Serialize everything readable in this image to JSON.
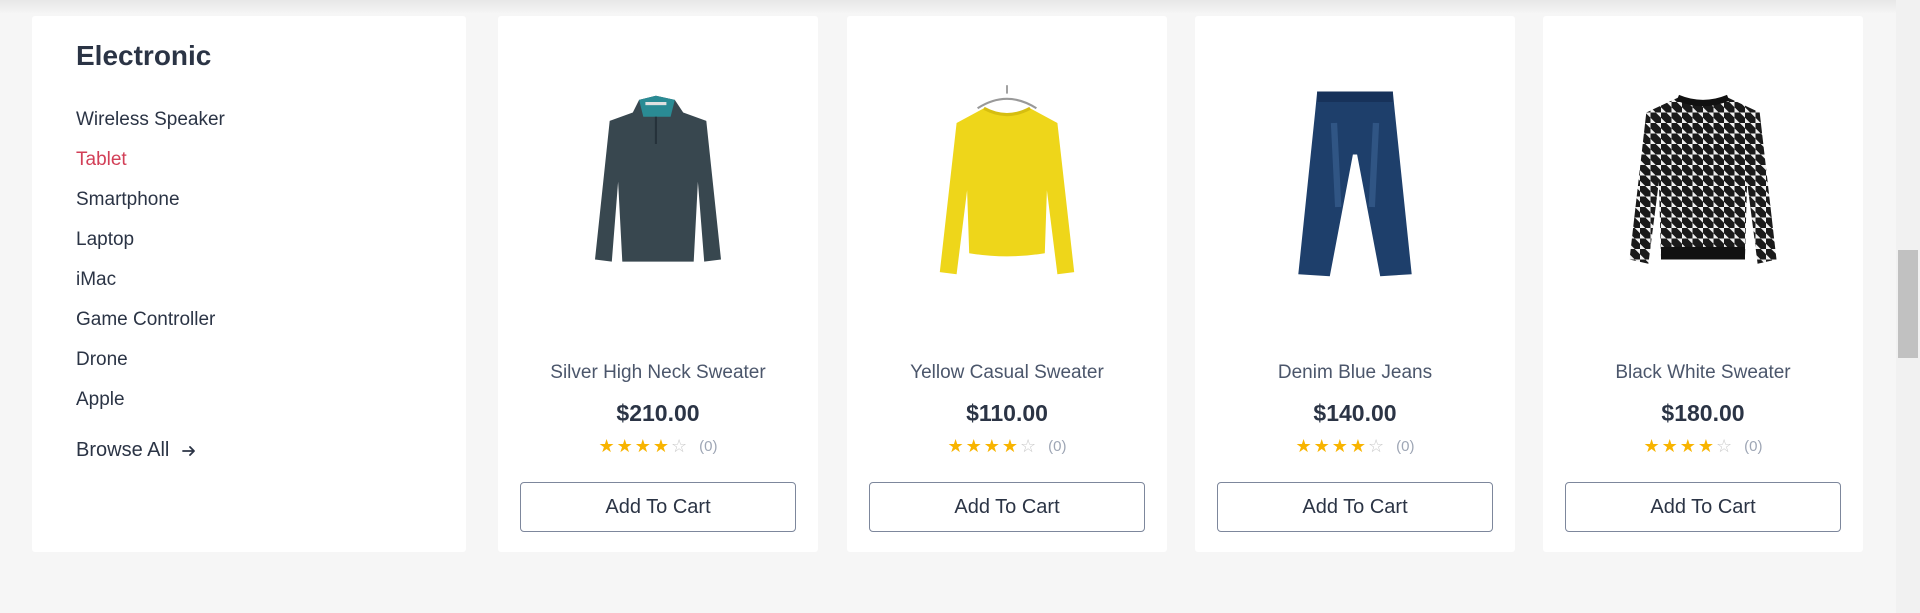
{
  "category": {
    "title": "Electronic",
    "items": [
      {
        "label": "Wireless Speaker",
        "active": false
      },
      {
        "label": "Tablet",
        "active": true
      },
      {
        "label": "Smartphone",
        "active": false
      },
      {
        "label": "Laptop",
        "active": false
      },
      {
        "label": "iMac",
        "active": false
      },
      {
        "label": "Game Controller",
        "active": false
      },
      {
        "label": "Drone",
        "active": false
      },
      {
        "label": "Apple",
        "active": false
      }
    ],
    "browse_all": "Browse All",
    "browse_icon": "arrow-right-icon",
    "active_color": "#d23f57"
  },
  "products": [
    {
      "name": "Silver High Neck Sweater",
      "price": "$210.00",
      "rating": 4,
      "reviews": "(0)",
      "button": "Add To Cart",
      "image": "high-neck-sweater",
      "image_color": "#38474f"
    },
    {
      "name": "Yellow Casual Sweater",
      "price": "$110.00",
      "rating": 4,
      "reviews": "(0)",
      "button": "Add To Cart",
      "image": "yellow-sweater",
      "image_color": "#eed61a"
    },
    {
      "name": "Denim Blue Jeans",
      "price": "$140.00",
      "rating": 4,
      "reviews": "(0)",
      "button": "Add To Cart",
      "image": "denim-jeans",
      "image_color": "#1e3f6b"
    },
    {
      "name": "Black White Sweater",
      "price": "$180.00",
      "rating": 4,
      "reviews": "(0)",
      "button": "Add To Cart",
      "image": "houndstooth-sweater",
      "image_color": "#1a1a1a"
    }
  ],
  "colors": {
    "star": "#f8b400",
    "star_empty": "#c9c9c9",
    "text": "#2b3445"
  }
}
